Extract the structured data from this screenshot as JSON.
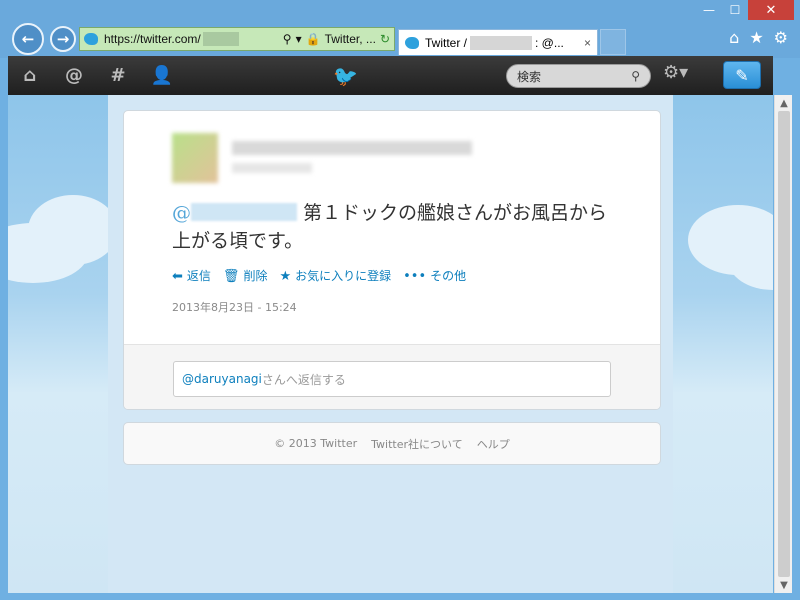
{
  "browser": {
    "address_prefix": "https://twitter.com/",
    "address_tab_label": "Twitter, ...",
    "tab_title_prefix": "Twitter /",
    "tab_title_suffix": ": @...",
    "tab_close": "×",
    "window": {
      "minimize": "—",
      "maximize": "☐",
      "close": "✕"
    }
  },
  "topbar": {
    "search_placeholder": "検索"
  },
  "tweet": {
    "mention_prefix": "@",
    "text": "第１ドックの艦娘さんがお風呂から上がる頃です。",
    "actions": [
      {
        "label": "返信",
        "icon": "reply-icon"
      },
      {
        "label": "削除",
        "icon": "trash-icon"
      },
      {
        "label": "お気に入りに登録",
        "icon": "star-icon"
      },
      {
        "label": "その他",
        "icon": "more-icon"
      }
    ],
    "timestamp": "2013年8月23日 - 15:24"
  },
  "reply": {
    "handle": "@daruyanagi",
    "placeholder_suffix": "さんへ返信する"
  },
  "footer": {
    "copyright": "© 2013 Twitter",
    "about": "Twitter社について",
    "help": "ヘルプ"
  }
}
